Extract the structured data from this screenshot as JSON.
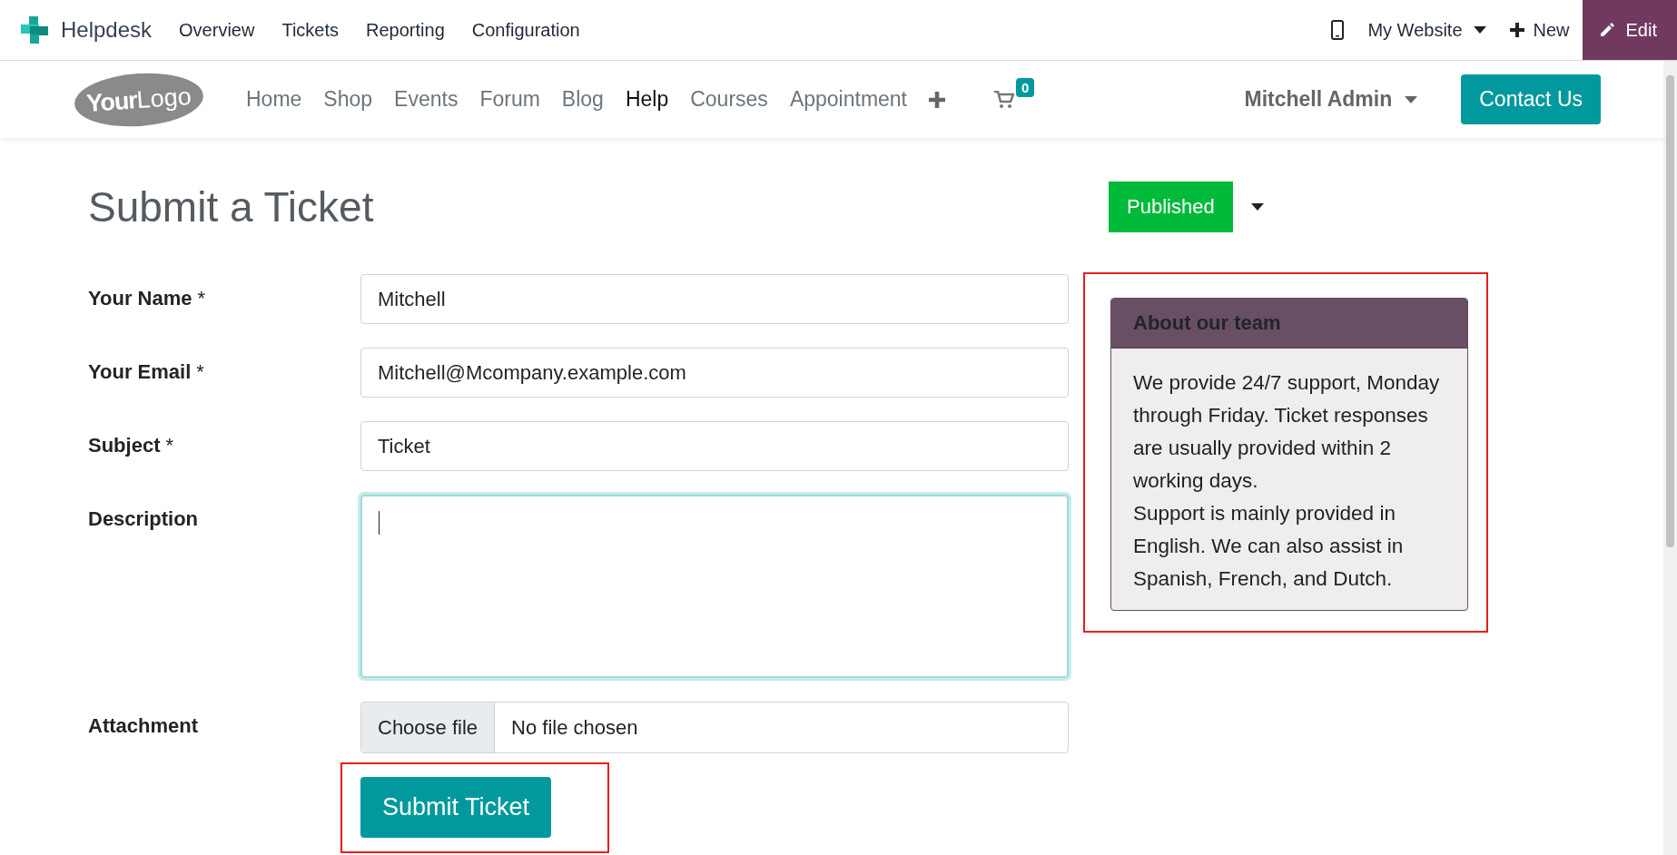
{
  "app_bar": {
    "app_name": "Helpdesk",
    "menu": [
      "Overview",
      "Tickets",
      "Reporting",
      "Configuration"
    ],
    "website_switcher": "My Website",
    "new_label": "New",
    "edit_label": "Edit"
  },
  "site_nav": {
    "logo": {
      "bold": "Your",
      "light": "Logo"
    },
    "links": [
      {
        "label": "Home",
        "selected": false
      },
      {
        "label": "Shop",
        "selected": false
      },
      {
        "label": "Events",
        "selected": false
      },
      {
        "label": "Forum",
        "selected": false
      },
      {
        "label": "Blog",
        "selected": false
      },
      {
        "label": "Help",
        "selected": true
      },
      {
        "label": "Courses",
        "selected": false
      },
      {
        "label": "Appointment",
        "selected": false
      }
    ],
    "cart_count": "0",
    "user": "Mitchell Admin",
    "contact_button": "Contact Us"
  },
  "page": {
    "title": "Submit a Ticket",
    "publish": {
      "label": "Published",
      "published": true
    }
  },
  "form": {
    "fields": [
      {
        "kind": "text",
        "label": "Your Name",
        "required_mark": "*",
        "value": "Mitchell"
      },
      {
        "kind": "text",
        "label": "Your Email",
        "required_mark": "*",
        "value": "Mitchell@Mcompany.example.com"
      },
      {
        "kind": "text",
        "label": "Subject",
        "required_mark": "*",
        "value": "Ticket"
      },
      {
        "kind": "textarea",
        "label": "Description",
        "focused": true
      },
      {
        "kind": "file",
        "label": "Attachment",
        "button": "Choose file",
        "status": "No file chosen"
      }
    ],
    "submit": "Submit Ticket"
  },
  "about": {
    "title": "About our team",
    "paragraphs": [
      "We provide 24/7 support, Monday through Friday. Ticket responses are usually provided within 2 working days.",
      "Support is mainly provided in English. We can also assist in Spanish, French, and Dutch."
    ]
  }
}
